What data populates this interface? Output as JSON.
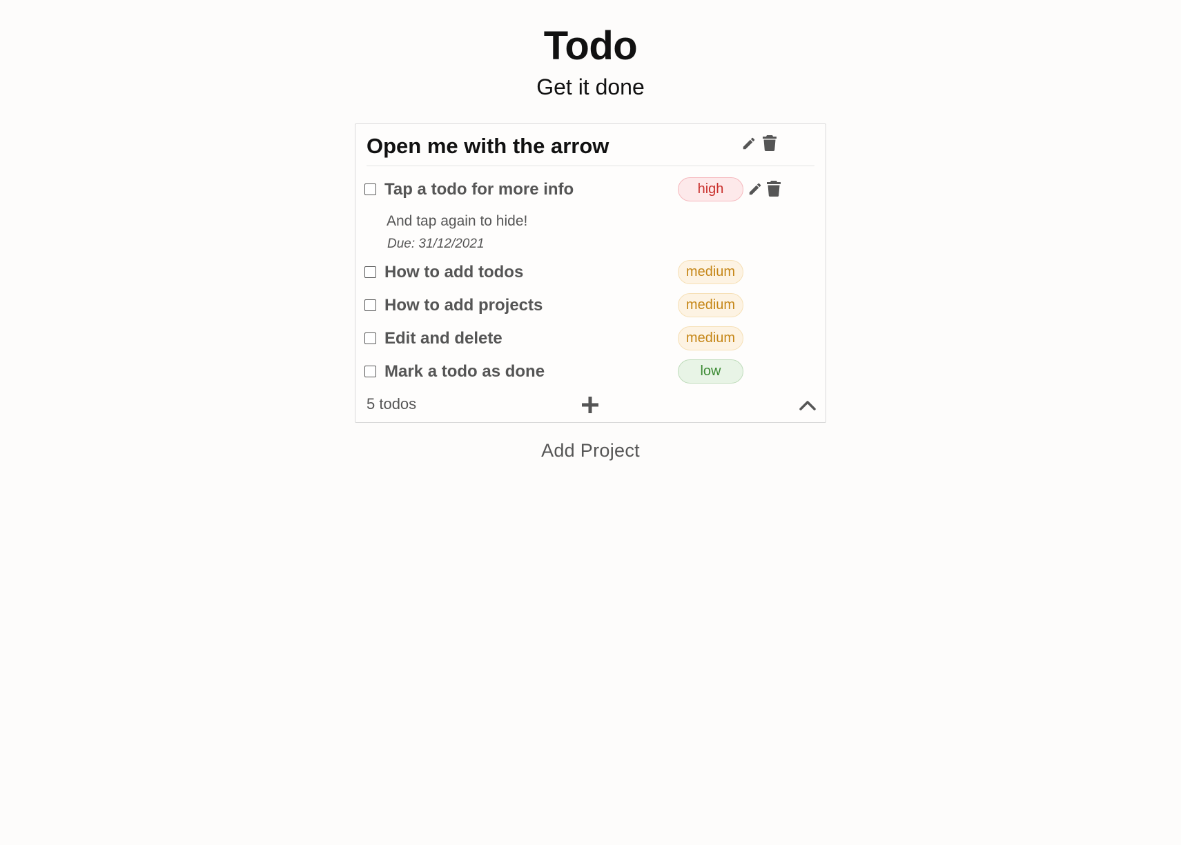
{
  "app": {
    "title": "Todo",
    "subtitle": "Get it done"
  },
  "project": {
    "title": "Open me with the arrow",
    "edit_icon": "pencil-icon",
    "delete_icon": "trash-icon",
    "todos": [
      {
        "title": "Tap a todo for more info",
        "priority": "high",
        "done": false,
        "expanded": true,
        "description": "And tap again to hide!",
        "due": "Due: 31/12/2021"
      },
      {
        "title": "How to add todos",
        "priority": "medium",
        "done": false
      },
      {
        "title": "How to add projects",
        "priority": "medium",
        "done": false
      },
      {
        "title": "Edit and delete",
        "priority": "medium",
        "done": false
      },
      {
        "title": "Mark a todo as done",
        "priority": "low",
        "done": false
      }
    ],
    "footer": {
      "count_label": "5 todos",
      "add_icon": "plus-icon",
      "collapse_icon": "chevron-up-icon"
    }
  },
  "actions": {
    "add_project_label": "Add Project"
  },
  "colors": {
    "background": "#fdfcfb",
    "high": "#c9302c",
    "medium": "#c58617",
    "low": "#3b8a33",
    "muted_text": "#555555"
  }
}
